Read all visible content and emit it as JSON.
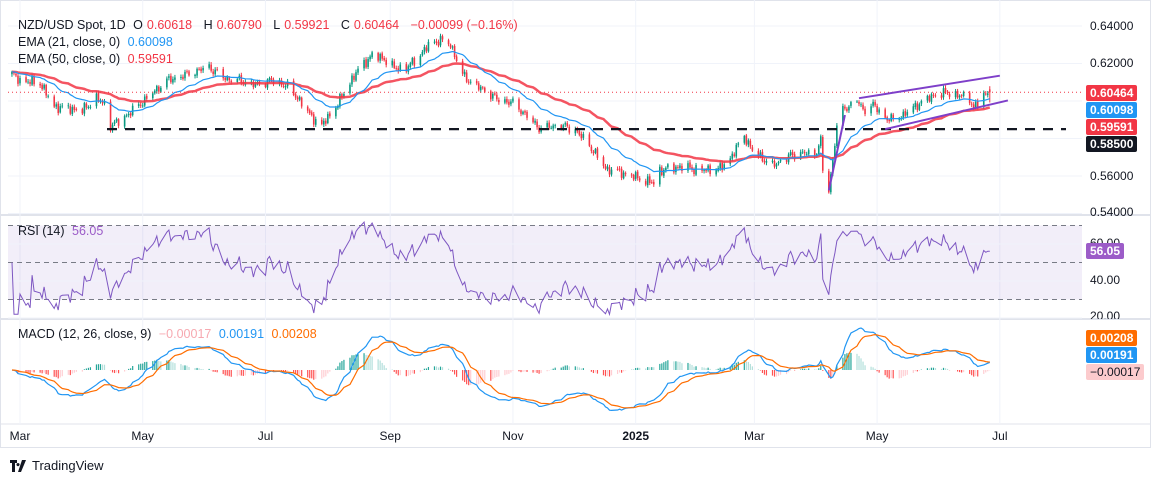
{
  "header": {
    "symbol": "NZD/USD Spot, 1D",
    "open_label": "O",
    "open": "0.60618",
    "high_label": "H",
    "high": "0.60790",
    "low_label": "L",
    "low": "0.59921",
    "close_label": "C",
    "close": "0.60464",
    "change": "−0.00099 (−0.16%)"
  },
  "indicators": {
    "ema21": {
      "label": "EMA (21, close, 0)",
      "value": "0.60098",
      "color": "#2196f3"
    },
    "ema50": {
      "label": "EMA (50, close, 0)",
      "value": "0.59591",
      "color": "#f23645"
    },
    "rsi": {
      "label": "RSI (14)",
      "value": "56.05",
      "color": "#7e57c2"
    },
    "macd": {
      "label": "MACD (12, 26, close, 9)",
      "histogram": "−0.00017",
      "macd": "0.00191",
      "signal": "0.00208",
      "macd_color": "#2196f3",
      "signal_color": "#ff6d00"
    }
  },
  "price_axis": {
    "ticks": [
      "0.64000",
      "0.62000",
      "0.56000",
      "0.54000"
    ],
    "badges": {
      "last": "0.60464",
      "ema21": "0.60098",
      "ema50": "0.59591",
      "support": "0.58500"
    }
  },
  "rsi_axis": {
    "ticks": [
      "60.00",
      "40.00",
      "20.00"
    ],
    "bands": [
      70,
      50,
      30
    ]
  },
  "macd_axis": {
    "badges": {
      "signal": "0.00208",
      "macd": "0.00191",
      "histogram": "−0.00017"
    }
  },
  "time_axis": [
    {
      "label": "Mar",
      "date": "2024-03-01"
    },
    {
      "label": "May",
      "date": "2024-05-01"
    },
    {
      "label": "Jul",
      "date": "2024-07-01"
    },
    {
      "label": "Sep",
      "date": "2024-09-01"
    },
    {
      "label": "Nov",
      "date": "2024-11-01"
    },
    {
      "label": "2025",
      "date": "2025-01-01"
    },
    {
      "label": "Mar",
      "date": "2025-03-01"
    },
    {
      "label": "May",
      "date": "2025-05-01"
    },
    {
      "label": "Jul",
      "date": "2025-07-01"
    }
  ],
  "branding": "TradingView",
  "chart_data": {
    "type": "candlestick",
    "title": "NZD/USD Spot, 1D",
    "ylim": [
      0.54,
      0.645
    ],
    "up_color": "#089981",
    "down_color": "#f23645",
    "approx_closes": [
      [
        "2024-02-26",
        0.6143
      ],
      [
        "2024-03-01",
        0.611
      ],
      [
        "2024-03-11",
        0.6095
      ],
      [
        "2024-03-18",
        0.597
      ],
      [
        "2024-04-01",
        0.595
      ],
      [
        "2024-04-08",
        0.6015
      ],
      [
        "2024-04-12",
        0.598
      ],
      [
        "2024-04-15",
        0.587
      ],
      [
        "2024-04-19",
        0.589
      ],
      [
        "2024-04-25",
        0.594
      ],
      [
        "2024-05-02",
        0.6005
      ],
      [
        "2024-05-13",
        0.611
      ],
      [
        "2024-05-17",
        0.612
      ],
      [
        "2024-05-29",
        0.6165
      ],
      [
        "2024-06-03",
        0.618
      ],
      [
        "2024-06-11",
        0.612
      ],
      [
        "2024-06-18",
        0.611
      ],
      [
        "2024-06-26",
        0.6085
      ],
      [
        "2024-07-03",
        0.611
      ],
      [
        "2024-07-11",
        0.6085
      ],
      [
        "2024-07-18",
        0.6005
      ],
      [
        "2024-07-23",
        0.5925
      ],
      [
        "2024-07-29",
        0.587
      ],
      [
        "2024-08-02",
        0.5925
      ],
      [
        "2024-08-07",
        0.6005
      ],
      [
        "2024-08-12",
        0.61
      ],
      [
        "2024-08-16",
        0.6165
      ],
      [
        "2024-08-23",
        0.6245
      ],
      [
        "2024-08-29",
        0.6225
      ],
      [
        "2024-09-03",
        0.6175
      ],
      [
        "2024-09-09",
        0.6175
      ],
      [
        "2024-09-16",
        0.6245
      ],
      [
        "2024-09-20",
        0.63
      ],
      [
        "2024-09-26",
        0.6325
      ],
      [
        "2024-10-01",
        0.63
      ],
      [
        "2024-10-07",
        0.614
      ],
      [
        "2024-10-11",
        0.61
      ],
      [
        "2024-10-18",
        0.6055
      ],
      [
        "2024-10-25",
        0.6005
      ],
      [
        "2024-11-01",
        0.599
      ],
      [
        "2024-11-05",
        0.595
      ],
      [
        "2024-11-14",
        0.5855
      ],
      [
        "2024-11-25",
        0.587
      ],
      [
        "2024-12-02",
        0.5845
      ],
      [
        "2024-12-09",
        0.5765
      ],
      [
        "2024-12-17",
        0.564
      ],
      [
        "2024-12-24",
        0.562
      ],
      [
        "2025-01-03",
        0.5587
      ],
      [
        "2025-01-10",
        0.556
      ],
      [
        "2025-01-13",
        0.563
      ],
      [
        "2025-01-23",
        0.565
      ],
      [
        "2025-02-03",
        0.563
      ],
      [
        "2025-02-12",
        0.564
      ],
      [
        "2025-02-17",
        0.5695
      ],
      [
        "2025-02-24",
        0.5815
      ],
      [
        "2025-02-28",
        0.5735
      ],
      [
        "2025-03-10",
        0.5655
      ],
      [
        "2025-03-19",
        0.571
      ],
      [
        "2025-03-26",
        0.5725
      ],
      [
        "2025-03-31",
        0.571
      ],
      [
        "2025-04-03",
        0.579
      ],
      [
        "2025-04-04",
        0.563
      ],
      [
        "2025-04-07",
        0.5523
      ],
      [
        "2025-04-09",
        0.5683
      ],
      [
        "2025-04-11",
        0.587
      ],
      [
        "2025-04-14",
        0.595
      ],
      [
        "2025-04-21",
        0.6005
      ],
      [
        "2025-04-24",
        0.595
      ],
      [
        "2025-04-29",
        0.598
      ],
      [
        "2025-05-05",
        0.591
      ],
      [
        "2025-05-09",
        0.59
      ],
      [
        "2025-05-14",
        0.5925
      ],
      [
        "2025-05-21",
        0.598
      ],
      [
        "2025-05-29",
        0.603
      ],
      [
        "2025-06-05",
        0.6045
      ],
      [
        "2025-06-10",
        0.603
      ],
      [
        "2025-06-16",
        0.6015
      ],
      [
        "2025-06-18",
        0.596
      ],
      [
        "2025-06-23",
        0.603
      ],
      [
        "2025-06-26",
        0.60464
      ]
    ],
    "last_candle": {
      "open": 0.60618,
      "high": 0.6079,
      "low": 0.59921,
      "close": 0.60464
    },
    "support_level": 0.585,
    "trendlines": [
      {
        "name": "channel-upper",
        "from": [
          "2025-04-22",
          0.6015
        ],
        "to": [
          "2025-07-01",
          0.6135
        ],
        "color": "#7e3fc9"
      },
      {
        "name": "channel-lower",
        "from": [
          "2025-05-05",
          0.585
        ],
        "to": [
          "2025-07-05",
          0.6003
        ],
        "color": "#7e3fc9"
      },
      {
        "name": "impulse-line",
        "from": [
          "2025-04-07",
          0.5523
        ],
        "to": [
          "2025-04-15",
          0.5925
        ],
        "color": "#7e3fc9"
      }
    ]
  }
}
